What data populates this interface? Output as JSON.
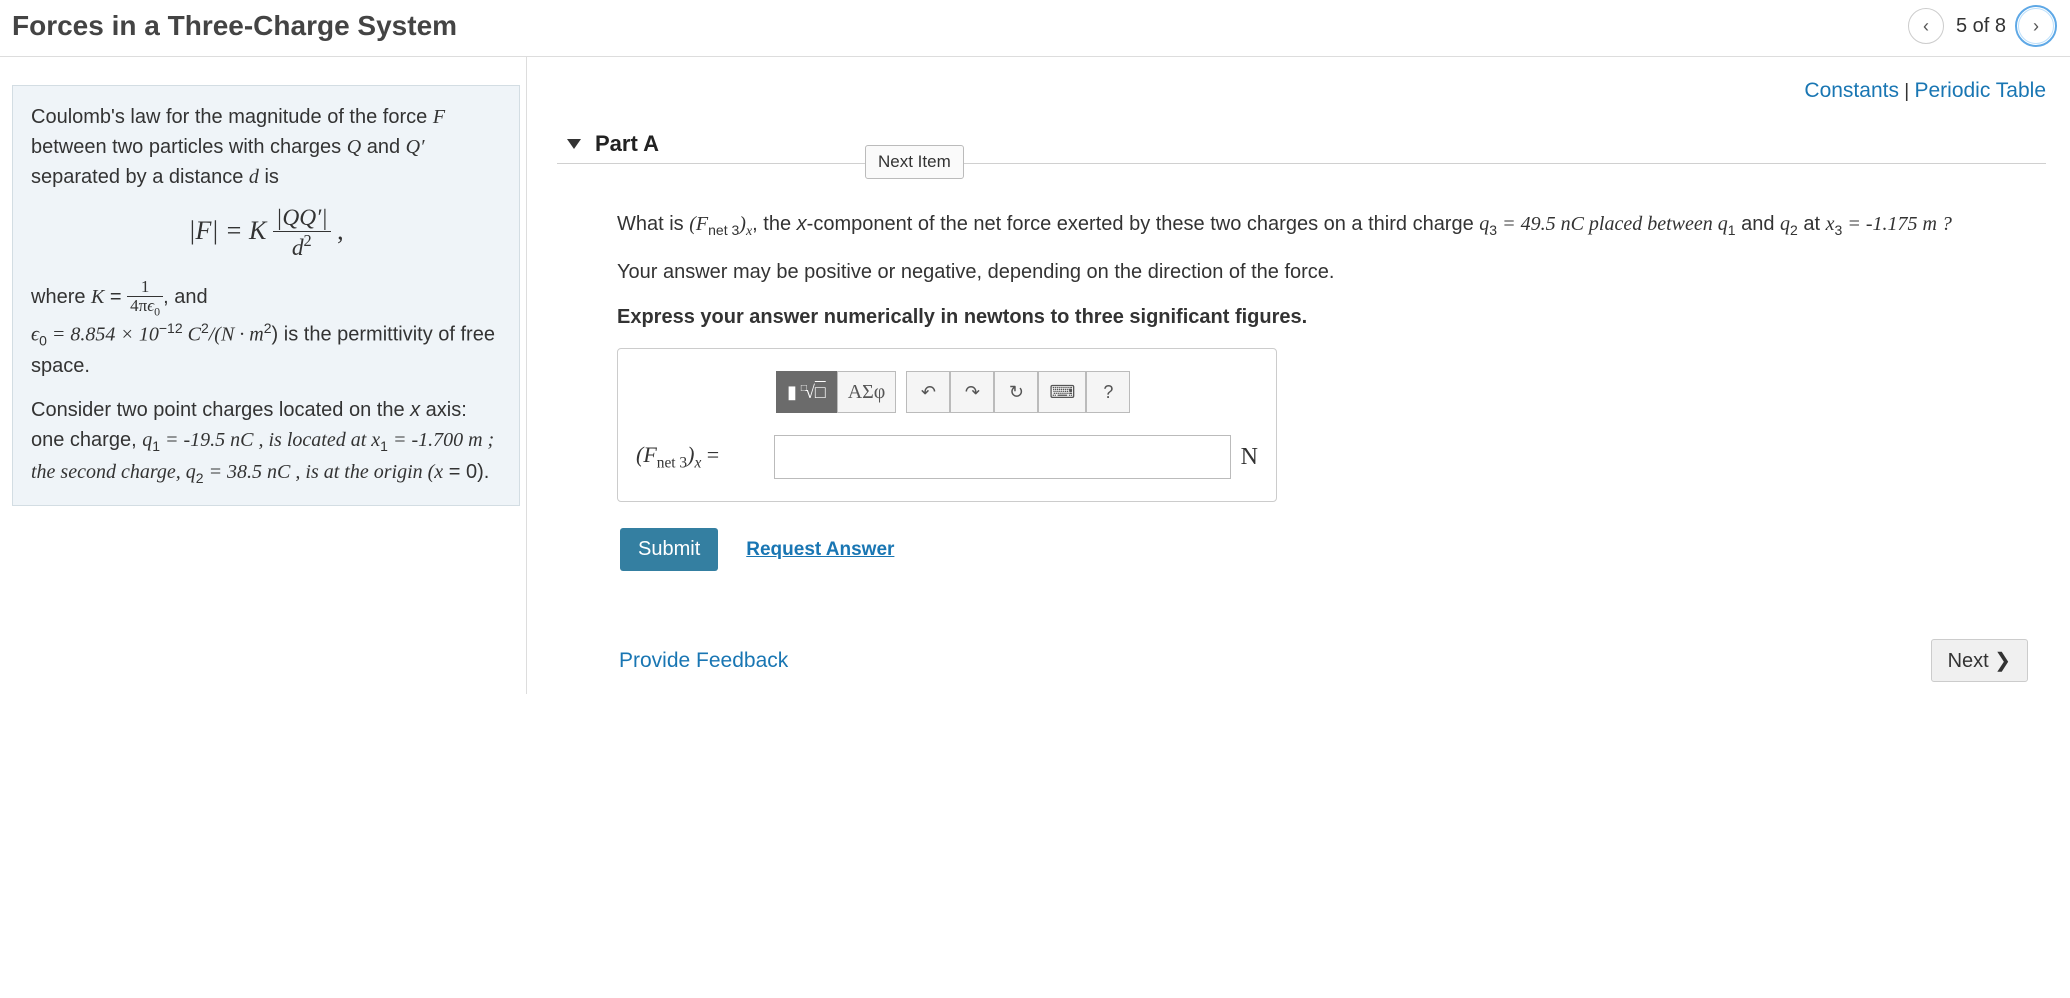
{
  "header": {
    "title": "Forces in a Three-Charge System",
    "counter": "5 of 8"
  },
  "info": {
    "p1_a": "Coulomb's law for the magnitude of the force ",
    "p1_F": "F",
    "p1_b": " between two particles with charges ",
    "p1_Q": "Q",
    "p1_c": " and ",
    "p1_Qp": "Q′",
    "p1_d": " separated by a distance ",
    "p1_dvar": "d",
    "p1_e": " is",
    "formula_lhs": "|F| = K",
    "formula_num": "|QQ′|",
    "formula_den": "d",
    "p2_a": "where ",
    "p2_K": "K",
    "p2_eq": " = ",
    "p2_num": "1",
    "p2_den_a": "4π",
    "p2_den_e0": "ϵ",
    "p2_b": ", and",
    "p3_e0": "ϵ",
    "p3_a": " = 8.854 × 10",
    "p3_exp": "−12",
    "p3_b": " C",
    "p3_c": "/(N · m",
    "p3_d": ") is the permittivity of free space.",
    "p4_a": "Consider two point charges located on the ",
    "p4_x": "x",
    "p4_b": " axis: one charge, ",
    "p4_q1": "q",
    "p4_c": " = -19.5 nC , is located at ",
    "p4_x1": "x",
    "p4_d": " = -1.700 m ; the second charge, ",
    "p4_q2": "q",
    "p4_e": " = 38.5 nC , is at the origin (",
    "p4_xv": "x",
    "p4_f": " = 0)."
  },
  "links": {
    "constants": "Constants",
    "sep": " | ",
    "periodic": "Periodic Table"
  },
  "part": {
    "label": "Part A",
    "next_item": "Next Item"
  },
  "question": {
    "q1_a": "What is ",
    "q1_fnet": "(F",
    "q1_sub": "net 3",
    "q1_paren": ")",
    "q1_xsub": "x",
    "q1_b": ", the ",
    "q1_xc": "x",
    "q1_c": "-component of the net force exerted by these two charges on a third charge ",
    "q1_q3": "q",
    "q1_d": " = 49.5 nC placed between ",
    "q1_q1": "q",
    "q1_e": " and ",
    "q1_q2": "q",
    "q1_f": " at ",
    "q1_x3": "x",
    "q1_g": " = -1.175 m ?",
    "q2": "Your answer may be positive or negative, depending on the direction of the force.",
    "q3": "Express your answer numerically in newtons to three significant figures."
  },
  "toolbar": {
    "templates": "▮",
    "greek": "ΑΣφ",
    "undo": "↶",
    "redo": "↷",
    "reset": "↻",
    "keyboard": "⌨",
    "help": "?"
  },
  "answer": {
    "label_a": "(F",
    "label_sub": "net 3",
    "label_b": ")",
    "label_x": "x",
    "label_eq": " = ",
    "unit": "N"
  },
  "actions": {
    "submit": "Submit",
    "request": "Request Answer"
  },
  "footer": {
    "feedback": "Provide Feedback",
    "next": "Next ❯"
  }
}
